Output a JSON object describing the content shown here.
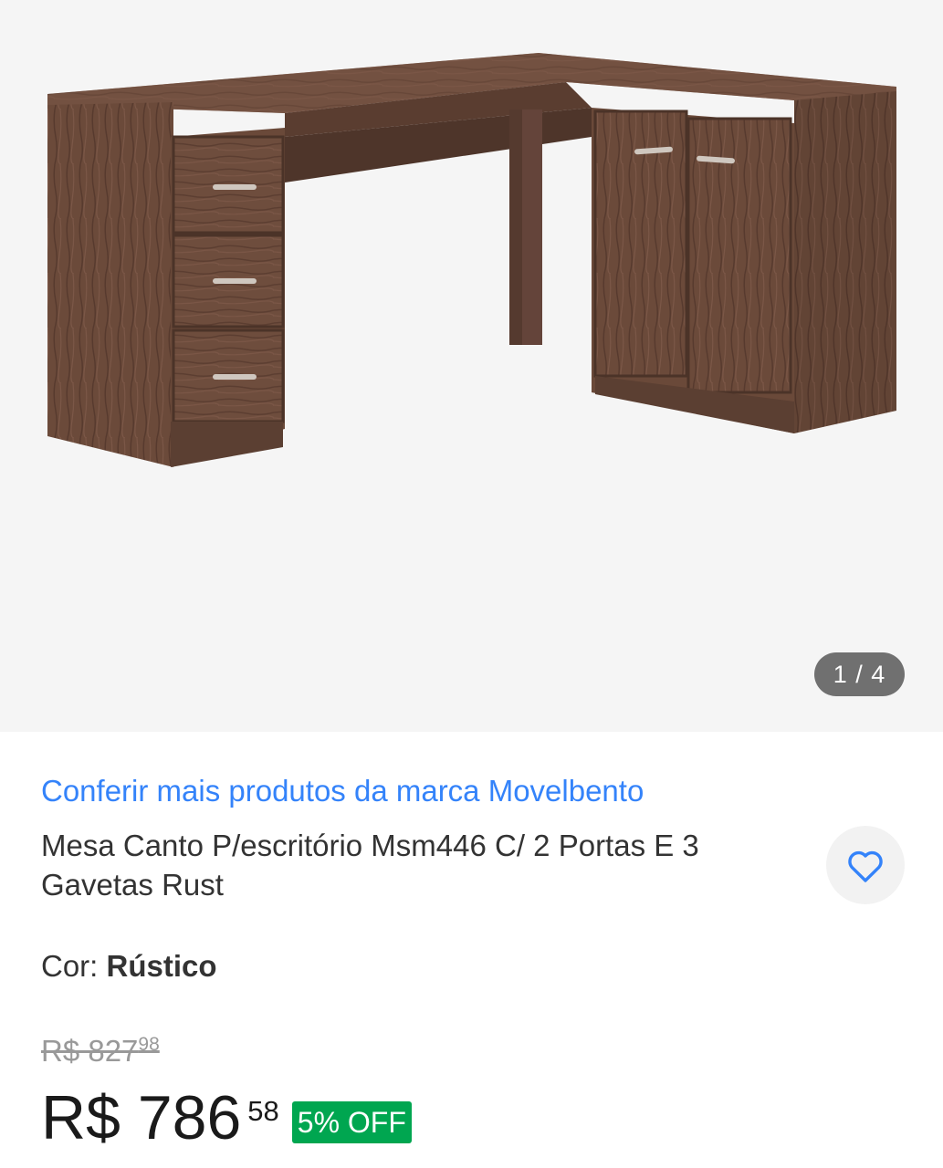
{
  "gallery": {
    "counter": "1 / 4",
    "image_alt": "Mesa Canto em L marrom rústico"
  },
  "product": {
    "brand_link": "Conferir mais produtos da marca Movelbento",
    "title": "Mesa Canto P/escritório Msm446 C/ 2 Portas E 3 Gavetas Rust",
    "variant_label": "Cor: ",
    "variant_value": "Rústico",
    "original_price": "R$ 827",
    "original_cents": "98",
    "price": "R$ 786",
    "price_cents": "58",
    "discount": "5% OFF"
  },
  "colors": {
    "accent_link": "#3483fa",
    "discount_bg": "#00a650",
    "wood": "#6b4a3a"
  },
  "icons": {
    "favorite": "heart-outline-icon"
  }
}
